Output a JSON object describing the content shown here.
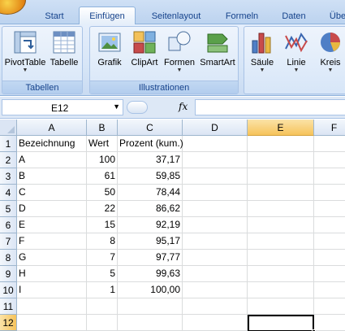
{
  "tabs": [
    "Start",
    "Einfügen",
    "Seitenlayout",
    "Formeln",
    "Daten",
    "Übe"
  ],
  "active_tab": "Einfügen",
  "ribbon": {
    "groups": [
      {
        "label": "Tabellen",
        "buttons": [
          "PivotTable",
          "Tabelle"
        ]
      },
      {
        "label": "Illustrationen",
        "buttons": [
          "Grafik",
          "ClipArt",
          "Formen",
          "SmartArt"
        ]
      },
      {
        "label": "",
        "buttons": [
          "Säule",
          "Linie",
          "Kreis"
        ]
      }
    ]
  },
  "formula_bar": {
    "name_box": "E12",
    "fx": "fx",
    "formula": ""
  },
  "columns": [
    "A",
    "B",
    "C",
    "D",
    "E",
    "F"
  ],
  "selected_column": "E",
  "rows": [
    {
      "n": "1",
      "A": "Bezeichnung",
      "B": "Wert",
      "C": "Prozent (kum.)"
    },
    {
      "n": "2",
      "A": "A",
      "B": "100",
      "C": "37,17"
    },
    {
      "n": "3",
      "A": "B",
      "B": "61",
      "C": "59,85"
    },
    {
      "n": "4",
      "A": "C",
      "B": "50",
      "C": "78,44"
    },
    {
      "n": "5",
      "A": "D",
      "B": "22",
      "C": "86,62"
    },
    {
      "n": "6",
      "A": "E",
      "B": "15",
      "C": "92,19"
    },
    {
      "n": "7",
      "A": "F",
      "B": "8",
      "C": "95,17"
    },
    {
      "n": "8",
      "A": "G",
      "B": "7",
      "C": "97,77"
    },
    {
      "n": "9",
      "A": "H",
      "B": "5",
      "C": "99,63"
    },
    {
      "n": "10",
      "A": "I",
      "B": "1",
      "C": "100,00"
    },
    {
      "n": "11",
      "A": "",
      "B": "",
      "C": ""
    },
    {
      "n": "12",
      "A": "",
      "B": "",
      "C": ""
    }
  ],
  "selected_row": "12"
}
